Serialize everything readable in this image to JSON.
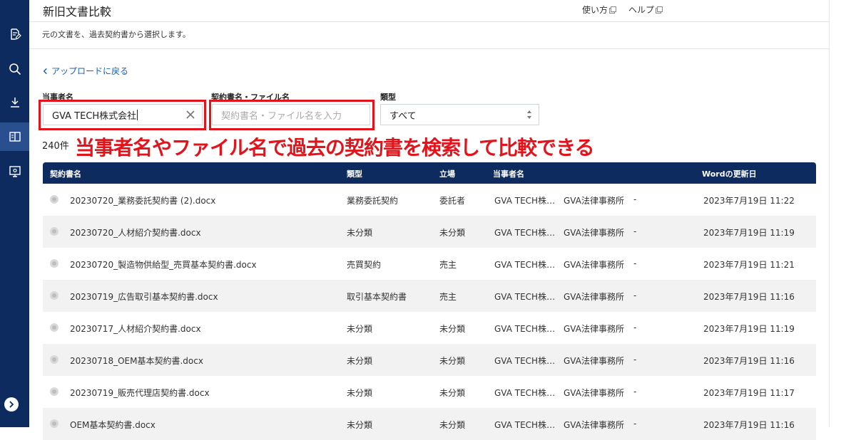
{
  "header": {
    "title": "新旧文書比較",
    "how_to_use": "使い方",
    "help": "ヘルプ"
  },
  "subtitle": "元の文書を、過去契約書から選択します。",
  "back_link": "アップロードに戻る",
  "filters": {
    "party_label": "当事者名",
    "party_value": "GVA TECH株式会社",
    "contract_label": "契約書名・ファイル名",
    "contract_placeholder": "契約書名・ファイル名を入力",
    "type_label": "類型",
    "type_value": "すべて"
  },
  "count": "240件",
  "annotation": "当事者名やファイル名で過去の契約書を検索して比較できる",
  "table": {
    "headers": [
      "契約書名",
      "類型",
      "立場",
      "当事者名",
      "Wordの更新日"
    ],
    "rows": [
      {
        "name": "20230720_業務委託契約書 (2).docx",
        "type": "業務委託契約",
        "position": "委託者",
        "party1": "GVA TECH株…",
        "party2": "GVA法律事務所",
        "party3": "-",
        "updated": "2023年7月19日 11:22"
      },
      {
        "name": "20230720_人材紹介契約書.docx",
        "type": "未分類",
        "position": "未分類",
        "party1": "GVA TECH株…",
        "party2": "GVA法律事務所",
        "party3": "-",
        "updated": "2023年7月19日 11:19"
      },
      {
        "name": "20230720_製造物供給型_売買基本契約書.docx",
        "type": "売買契約",
        "position": "売主",
        "party1": "GVA TECH株…",
        "party2": "GVA法律事務所",
        "party3": "-",
        "updated": "2023年7月19日 11:21"
      },
      {
        "name": "20230719_広告取引基本契約書.docx",
        "type": "取引基本契約書",
        "position": "売主",
        "party1": "GVA TECH株…",
        "party2": "GVA法律事務所",
        "party3": "-",
        "updated": "2023年7月19日 11:16"
      },
      {
        "name": "20230717_人材紹介契約書.docx",
        "type": "未分類",
        "position": "未分類",
        "party1": "GVA TECH株…",
        "party2": "GVA法律事務所",
        "party3": "-",
        "updated": "2023年7月19日 11:19"
      },
      {
        "name": "20230718_OEM基本契約書.docx",
        "type": "未分類",
        "position": "未分類",
        "party1": "GVA TECH株…",
        "party2": "GVA法律事務所",
        "party3": "-",
        "updated": "2023年7月19日 11:16"
      },
      {
        "name": "20230719_販売代理店契約書.docx",
        "type": "未分類",
        "position": "未分類",
        "party1": "GVA TECH株…",
        "party2": "GVA法律事務所",
        "party3": "-",
        "updated": "2023年7月19日 11:17"
      },
      {
        "name": "OEM基本契約書.docx",
        "type": "未分類",
        "position": "未分類",
        "party1": "GVA TECH株…",
        "party2": "GVA法律事務所",
        "party3": "-",
        "updated": "2023年7月19日 11:16"
      }
    ]
  }
}
